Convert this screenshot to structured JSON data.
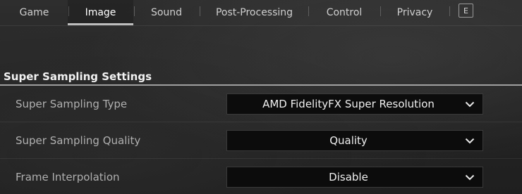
{
  "tabs": [
    {
      "label": "Game",
      "active": false
    },
    {
      "label": "Image",
      "active": true
    },
    {
      "label": "Sound",
      "active": false
    },
    {
      "label": "Post-Processing",
      "active": false
    },
    {
      "label": "Control",
      "active": false
    },
    {
      "label": "Privacy",
      "active": false
    }
  ],
  "key_hint": "E",
  "section": {
    "title": "Super Sampling Settings",
    "rows": [
      {
        "label": "Super Sampling Type",
        "value": "AMD FidelityFX Super Resolution",
        "icon": "chevron-down-icon"
      },
      {
        "label": "Super Sampling Quality",
        "value": "Quality",
        "icon": "chevron-down-icon"
      },
      {
        "label": "Frame Interpolation",
        "value": "Disable",
        "icon": "chevron-down-icon"
      }
    ]
  }
}
